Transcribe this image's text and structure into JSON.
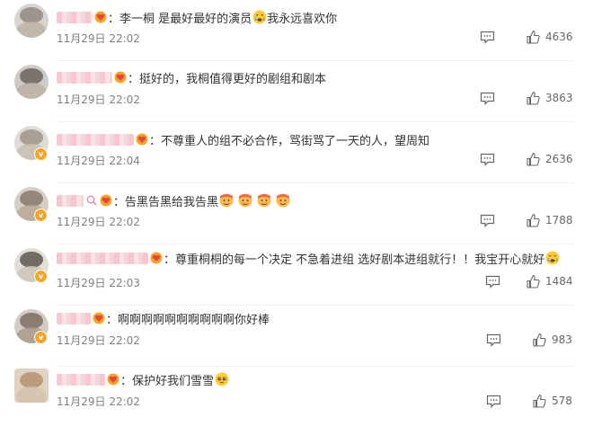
{
  "colors": {
    "accent": "#f5a623",
    "username_blur": "#f7c6cf",
    "text": "#333333",
    "meta": "#808080"
  },
  "comments": [
    {
      "content": "李一桐 是最好最好的演员",
      "emoji_after": "crying-face",
      "content_tail": "我永远喜欢你",
      "time": "11月29日 22:02",
      "likes": "4636"
    },
    {
      "content": "挺好的，我桐值得更好的剧组和剧本",
      "time": "11月29日 22:02",
      "likes": "3863"
    },
    {
      "content": "不尊重人的组不必合作，骂街骂了一天的人，望周知",
      "time": "11月29日 22:04",
      "likes": "2636"
    },
    {
      "content": "告黑告黑给我告黑",
      "emojis": [
        "hot-face",
        "hot-face",
        "hot-face",
        "hot-face"
      ],
      "time": "11月29日 22:02",
      "likes": "1788"
    },
    {
      "content": "尊重桐桐的每一个决定 不急着进组 选好剧本进组就行！！我宝开心就好",
      "emoji_after": "crying-face",
      "time": "11月29日 22:03",
      "likes": "1484"
    },
    {
      "content": "啊啊啊啊啊啊啊啊啊啊你好棒",
      "time": "11月29日 22:02",
      "likes": "983"
    },
    {
      "content": "保护好我们雪雪",
      "emoji_after": "pleading-face",
      "time": "11月29日 22:02",
      "likes": "578"
    }
  ]
}
